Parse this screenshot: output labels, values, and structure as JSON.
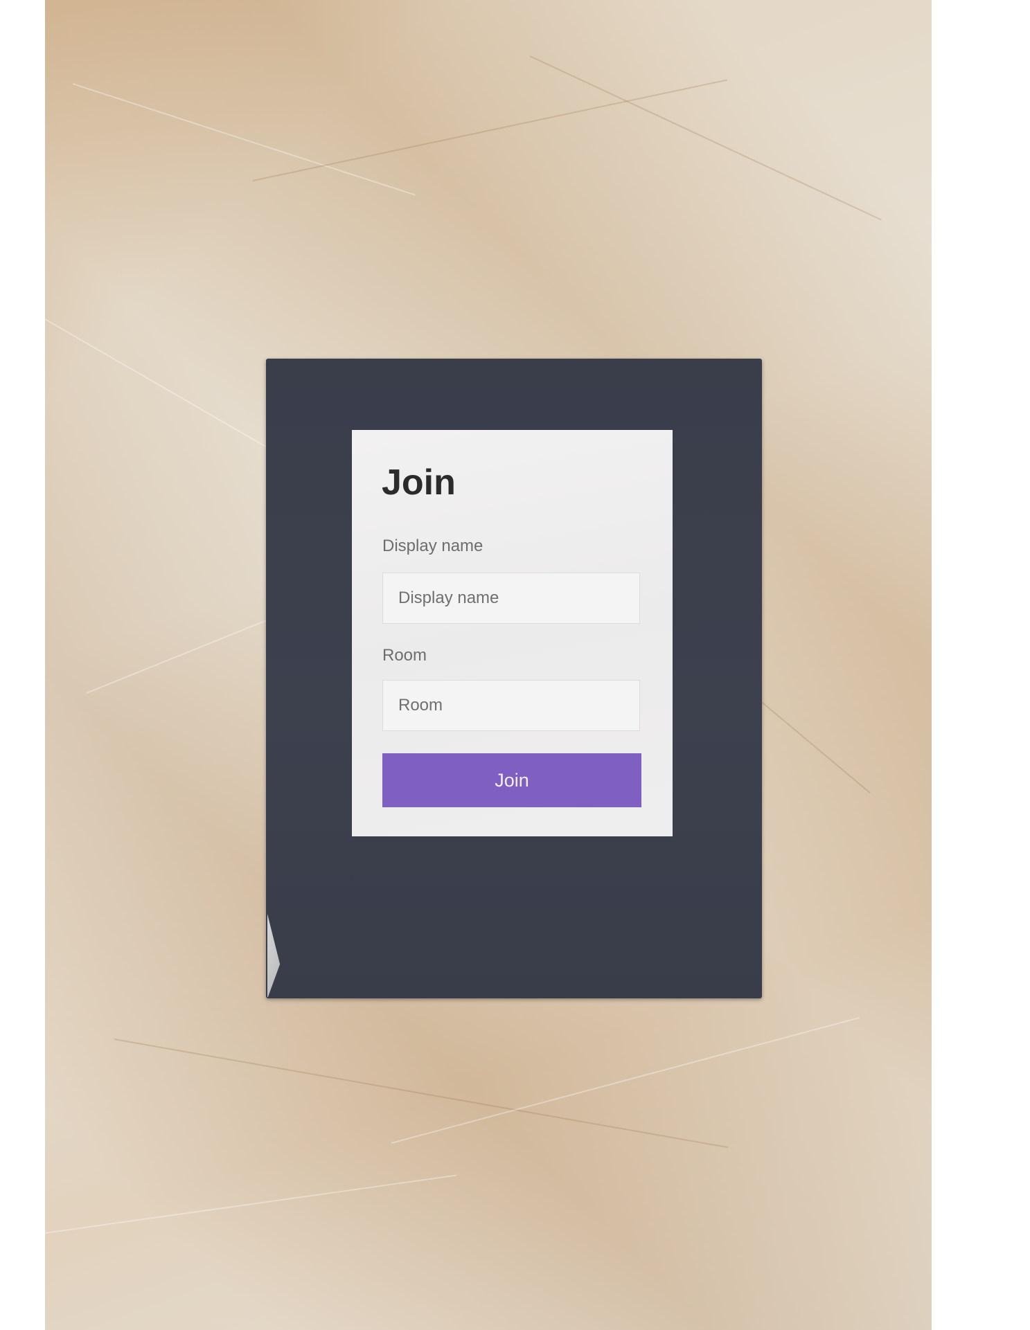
{
  "join_form": {
    "title": "Join",
    "display_name": {
      "label": "Display name",
      "placeholder": "Display name",
      "value": ""
    },
    "room": {
      "label": "Room",
      "placeholder": "Room",
      "value": ""
    },
    "submit_label": "Join"
  },
  "colors": {
    "poster_background": "#3c404d",
    "card_background": "#efeeee",
    "accent": "#7f5fc2",
    "paper": "#ddd3c2"
  }
}
